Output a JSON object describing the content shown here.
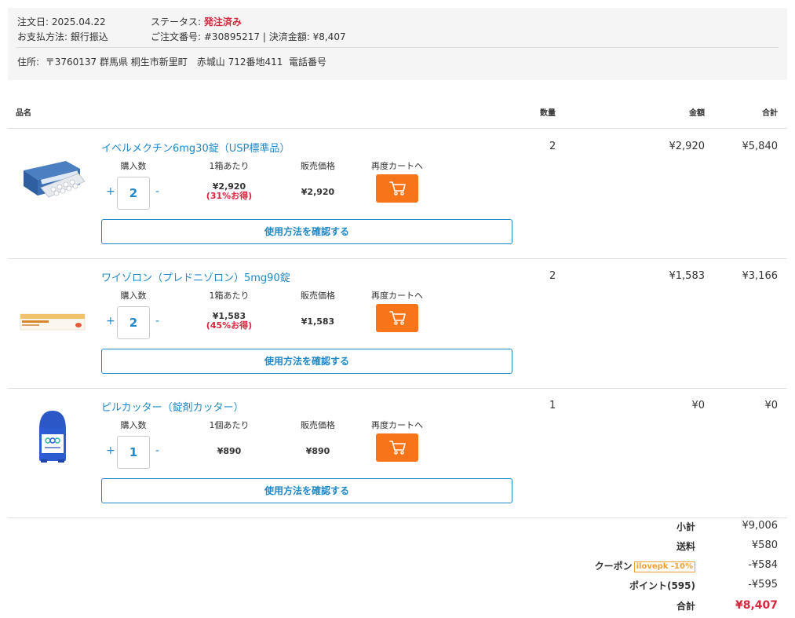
{
  "order": {
    "date_label": "注文日:",
    "date": "2025.04.22",
    "payment_label": "お支払方法:",
    "payment": "銀行振込",
    "status_label": "ステータス:",
    "status": "発注済み",
    "order_number_label": "ご注文番号:",
    "order_number": "#30895217",
    "separator": "|",
    "settled_label": "決済金額:",
    "settled_amount": "¥8,407",
    "address_label": "住所:",
    "address": "〒3760137 群馬県 桐生市新里町　赤城山 712番地411",
    "phone_label": "電話番号"
  },
  "table": {
    "headers": {
      "product": "品名",
      "quantity": "数量",
      "amount": "金額",
      "total": "合計"
    }
  },
  "items": [
    {
      "name": "イベルメクチン6mg30錠（USP標準品）",
      "qty_label": "購入数",
      "per_label": "1箱あたり",
      "price_label": "販売価格",
      "recart_label": "再度カートへ",
      "plus": "+",
      "minus": "-",
      "qty": "2",
      "per_price": "¥2,920",
      "per_save": "(31%お得)",
      "sale_price": "¥2,920",
      "usage_button": "使用方法を確認する",
      "col_qty": "2",
      "col_amount": "¥2,920",
      "col_total": "¥5,840",
      "cart_icon": "shopping-cart-icon"
    },
    {
      "name": "ワイゾロン（プレドニゾロン）5mg90錠",
      "qty_label": "購入数",
      "per_label": "1箱あたり",
      "price_label": "販売価格",
      "recart_label": "再度カートへ",
      "plus": "+",
      "minus": "-",
      "qty": "2",
      "per_price": "¥1,583",
      "per_save": "(45%お得)",
      "sale_price": "¥1,583",
      "usage_button": "使用方法を確認する",
      "col_qty": "2",
      "col_amount": "¥1,583",
      "col_total": "¥3,166",
      "cart_icon": "shopping-cart-icon"
    },
    {
      "name": "ピルカッター（錠剤カッター）",
      "qty_label": "購入数",
      "per_label": "1個あたり",
      "price_label": "販売価格",
      "recart_label": "再度カートへ",
      "plus": "+",
      "minus": "-",
      "qty": "1",
      "per_price": "¥890",
      "per_save": "",
      "sale_price": "¥890",
      "usage_button": "使用方法を確認する",
      "col_qty": "1",
      "col_amount": "¥0",
      "col_total": "¥0",
      "cart_icon": "shopping-cart-icon"
    }
  ],
  "summary": {
    "subtotal_label": "小計",
    "subtotal": "¥9,006",
    "shipping_label": "送料",
    "shipping": "¥580",
    "coupon_label": "クーポン",
    "coupon_code": "ilovepk -10%",
    "coupon_discount": "-¥584",
    "points_label": "ポイント(595)",
    "points_discount": "-¥595",
    "total_label": "合計",
    "total": "¥8,407"
  },
  "colors": {
    "link": "#1e88c8",
    "accent_orange": "#f77419",
    "status_red": "#d7263d",
    "coupon_orange": "#f0a030"
  }
}
